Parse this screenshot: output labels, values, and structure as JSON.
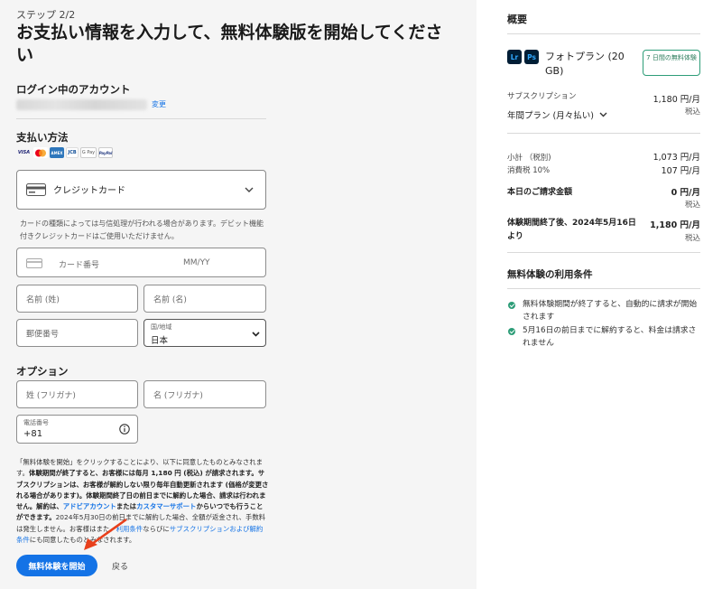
{
  "header": {
    "step": "ステップ 2/2",
    "title": "お支払い情報を入力して、無料体験版を開始してください"
  },
  "account": {
    "heading": "ログイン中のアカウント",
    "change_label": "変更"
  },
  "payment": {
    "heading": "支払い方法",
    "methods": [
      "VISA",
      "MC",
      "AMEX",
      "JCB",
      "G Pay",
      "PayPal"
    ],
    "method_select": "クレジットカード",
    "note": "カードの種類によっては与信処理が行われる場合があります。デビット機能付きクレジットカードはご使用いただけません。",
    "card_number_placeholder": "カード番号",
    "expiry_placeholder": "MM/YY",
    "last_name_placeholder": "名前 (姓)",
    "first_name_placeholder": "名前 (名)",
    "postal_placeholder": "郵便番号",
    "country_label": "国/地域",
    "country_value": "日本"
  },
  "options": {
    "heading": "オプション",
    "last_kana_placeholder": "姓 (フリガナ)",
    "first_kana_placeholder": "名 (フリガナ)",
    "phone_label": "電話番号",
    "phone_value": "+81"
  },
  "legal": {
    "p1": "「無料体験を開始」をクリックすることにより、以下に同意したものとみなされます。",
    "b1": "体験期間が終了すると、お客様には毎月 1,180 円 (税込) が請求されます。サブスクリプションは、お客様が解約しない限り毎年自動更新されます (価格が変更される場合があります)。体験期間終了日の前日までに解約した場合、請求は行われません。解約は、",
    "link1": "アドビアカウント",
    "b2": "または",
    "link2": "カスタマーサポート",
    "b3": "からいつでも行うことができます。",
    "p2": "2024年5月30日の前日までに解約した場合、全額が返金され、手数料は発生しません。お客様はまた、",
    "link3": "利用条件",
    "p3": "ならびに",
    "link4": "サブスクリプションおよび解約条件",
    "p4": "にも同意したものとみなされます。"
  },
  "actions": {
    "start_label": "無料体験を開始",
    "back_label": "戻る"
  },
  "summary": {
    "heading": "概要",
    "app_icons": [
      "Lr",
      "Ps"
    ],
    "plan_name": "フォトプラン (20 GB)",
    "trial_badge": "7 日間の無料体験",
    "subscription_label": "サブスクリプション",
    "subscription_price": "1,180 円/月",
    "tax_included": "税込",
    "plan_term": "年間プラン (月々払い)",
    "subtotal_label": "小計 （税別)",
    "subtotal_value": "1,073 円/月",
    "tax_label": "消費税 10%",
    "tax_value": "107 円/月",
    "today_label": "本日のご請求金額",
    "today_value": "0 円/月",
    "after_label": "体験期間終了後、2024年5月16日より",
    "after_value": "1,180 円/月",
    "terms_heading": "無料体験の利用条件",
    "terms": [
      "無料体験期間が終了すると、自動的に請求が開始されます",
      "5月16日の前日までに解約すると、料金は請求されません"
    ]
  },
  "colors": {
    "accent": "#1473e6",
    "success": "#2d9d78",
    "annotation_arrow": "#e8401c"
  }
}
